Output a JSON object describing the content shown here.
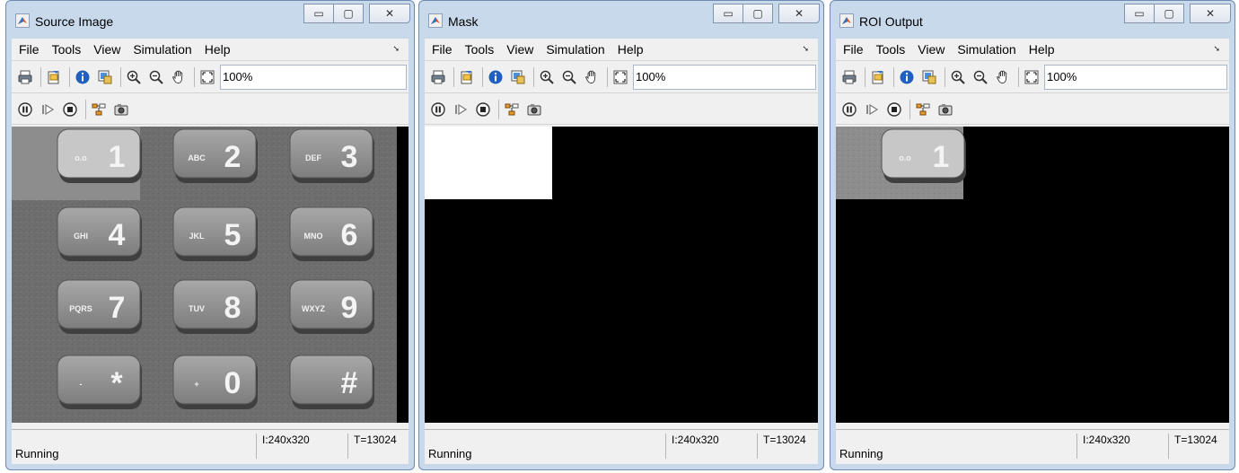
{
  "menu": [
    "File",
    "Tools",
    "View",
    "Simulation",
    "Help"
  ],
  "zoom": "100%",
  "status": {
    "state": "Running",
    "dims": "I:240x320",
    "time": "T=13024"
  },
  "icons": [
    "print-icon",
    "open-icon",
    "info-icon",
    "export-icon",
    "zoom-in-icon",
    "zoom-out-icon",
    "pan-icon",
    "fit-icon",
    "pause-icon",
    "step-icon",
    "stop-icon",
    "highlight-icon",
    "snapshot-icon"
  ],
  "windows": [
    {
      "title": "Source Image",
      "display": "keypad"
    },
    {
      "title": "Mask",
      "display": "mask"
    },
    {
      "title": "ROI Output",
      "display": "roi"
    }
  ],
  "keypad": {
    "keys": [
      {
        "digit": "1",
        "letters": "o.o"
      },
      {
        "digit": "2",
        "letters": "ABC"
      },
      {
        "digit": "3",
        "letters": "DEF"
      },
      {
        "digit": "4",
        "letters": "GHI"
      },
      {
        "digit": "5",
        "letters": "JKL"
      },
      {
        "digit": "6",
        "letters": "MNO"
      },
      {
        "digit": "7",
        "letters": "PQRS"
      },
      {
        "digit": "8",
        "letters": "TUV"
      },
      {
        "digit": "9",
        "letters": "WXYZ"
      },
      {
        "digit": "*",
        "letters": "-"
      },
      {
        "digit": "0",
        "letters": "+"
      },
      {
        "digit": "#",
        "letters": ""
      }
    ]
  },
  "window_controls": {
    "minimize": "▭",
    "maximize": "▢",
    "close": "✕"
  }
}
